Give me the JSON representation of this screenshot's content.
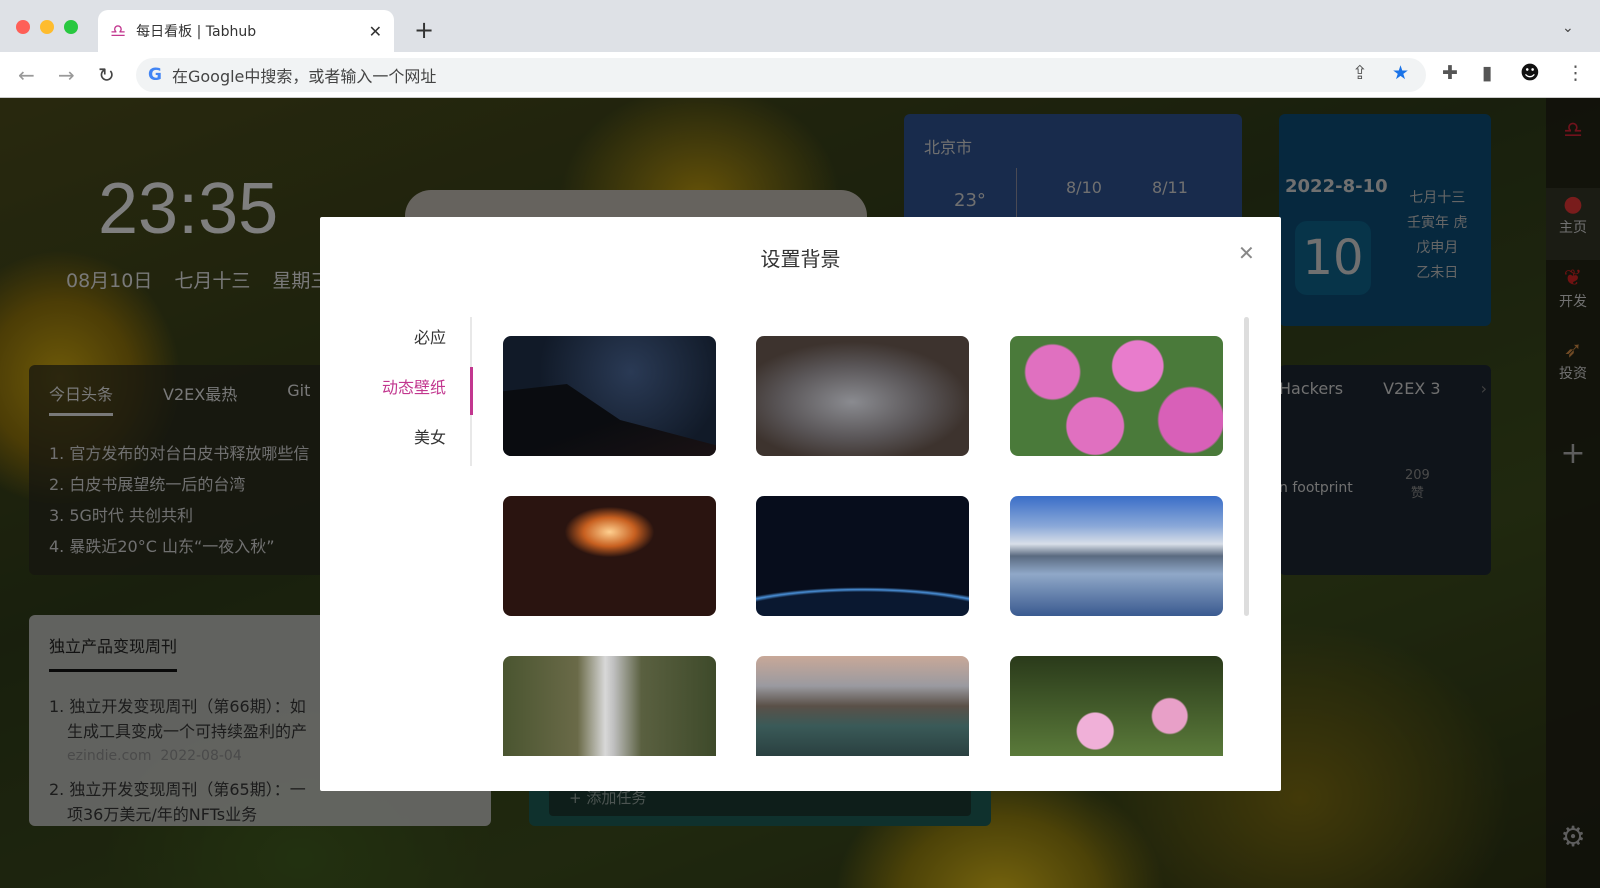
{
  "browser": {
    "tab_title": "每日看板 | Tabhub",
    "address_placeholder": "在Google中搜索，或者输入一个网址",
    "colors": {
      "bookmark_star": "#1a73e8",
      "accent": "#c2378f"
    }
  },
  "dashboard": {
    "clock": "23:35",
    "date": [
      "08月10日",
      "七月十三",
      "星期三"
    ],
    "news": {
      "tabs": [
        "今日头条",
        "V2EX最热",
        "Git"
      ],
      "items": [
        "1. 官方发布的对台白皮书释放哪些信",
        "2. 白皮书展望统一后的台湾",
        "3. 5G时代 共创共利",
        "4. 暴跌近20°C 山东“一夜入秋”"
      ]
    },
    "weekly": {
      "title": "独立产品变现周刊",
      "items": [
        {
          "title": "1. 独立开发变现周刊（第66期）：如",
          "title2": "生成工具变成一个可持续盈利的产",
          "source": "ezindie.com",
          "date": "2022-08-04"
        },
        {
          "title": "2. 独立开发变现周刊（第65期）：一",
          "title2": "项36万美元/年的NFTs业务"
        }
      ]
    },
    "weather": {
      "city": "北京市",
      "days": [
        "8/10",
        "8/11"
      ],
      "temp": "23°"
    },
    "calendar": {
      "date": "2022-8-10",
      "day": "10",
      "lunar": [
        "七月十三",
        "壬寅年 虎",
        "戊申月",
        "乙未日"
      ]
    },
    "hackers": {
      "tabs": [
        "Hackers",
        "V2EX 3"
      ],
      "item": "n footprint",
      "count": "209",
      "count_label": "赞"
    },
    "todo": {
      "add_label": "+ 添加任务"
    },
    "sidebar": [
      {
        "label": "主页",
        "icon": "strawberry-icon"
      },
      {
        "label": "开发",
        "icon": "cherry-icon"
      },
      {
        "label": "投资",
        "icon": "rocket-icon"
      }
    ]
  },
  "modal": {
    "title": "设置背景",
    "menu": [
      {
        "label": "必应",
        "active": false
      },
      {
        "label": "动态壁纸",
        "active": true
      },
      {
        "label": "美女",
        "active": false
      }
    ],
    "thumbnails": [
      "night-sky",
      "cat",
      "pink-flowers",
      "fireplace-owl",
      "earth-from-space",
      "mountain-lake",
      "waterfall-canyon",
      "lake-island",
      "cosmos-butterfly"
    ]
  }
}
